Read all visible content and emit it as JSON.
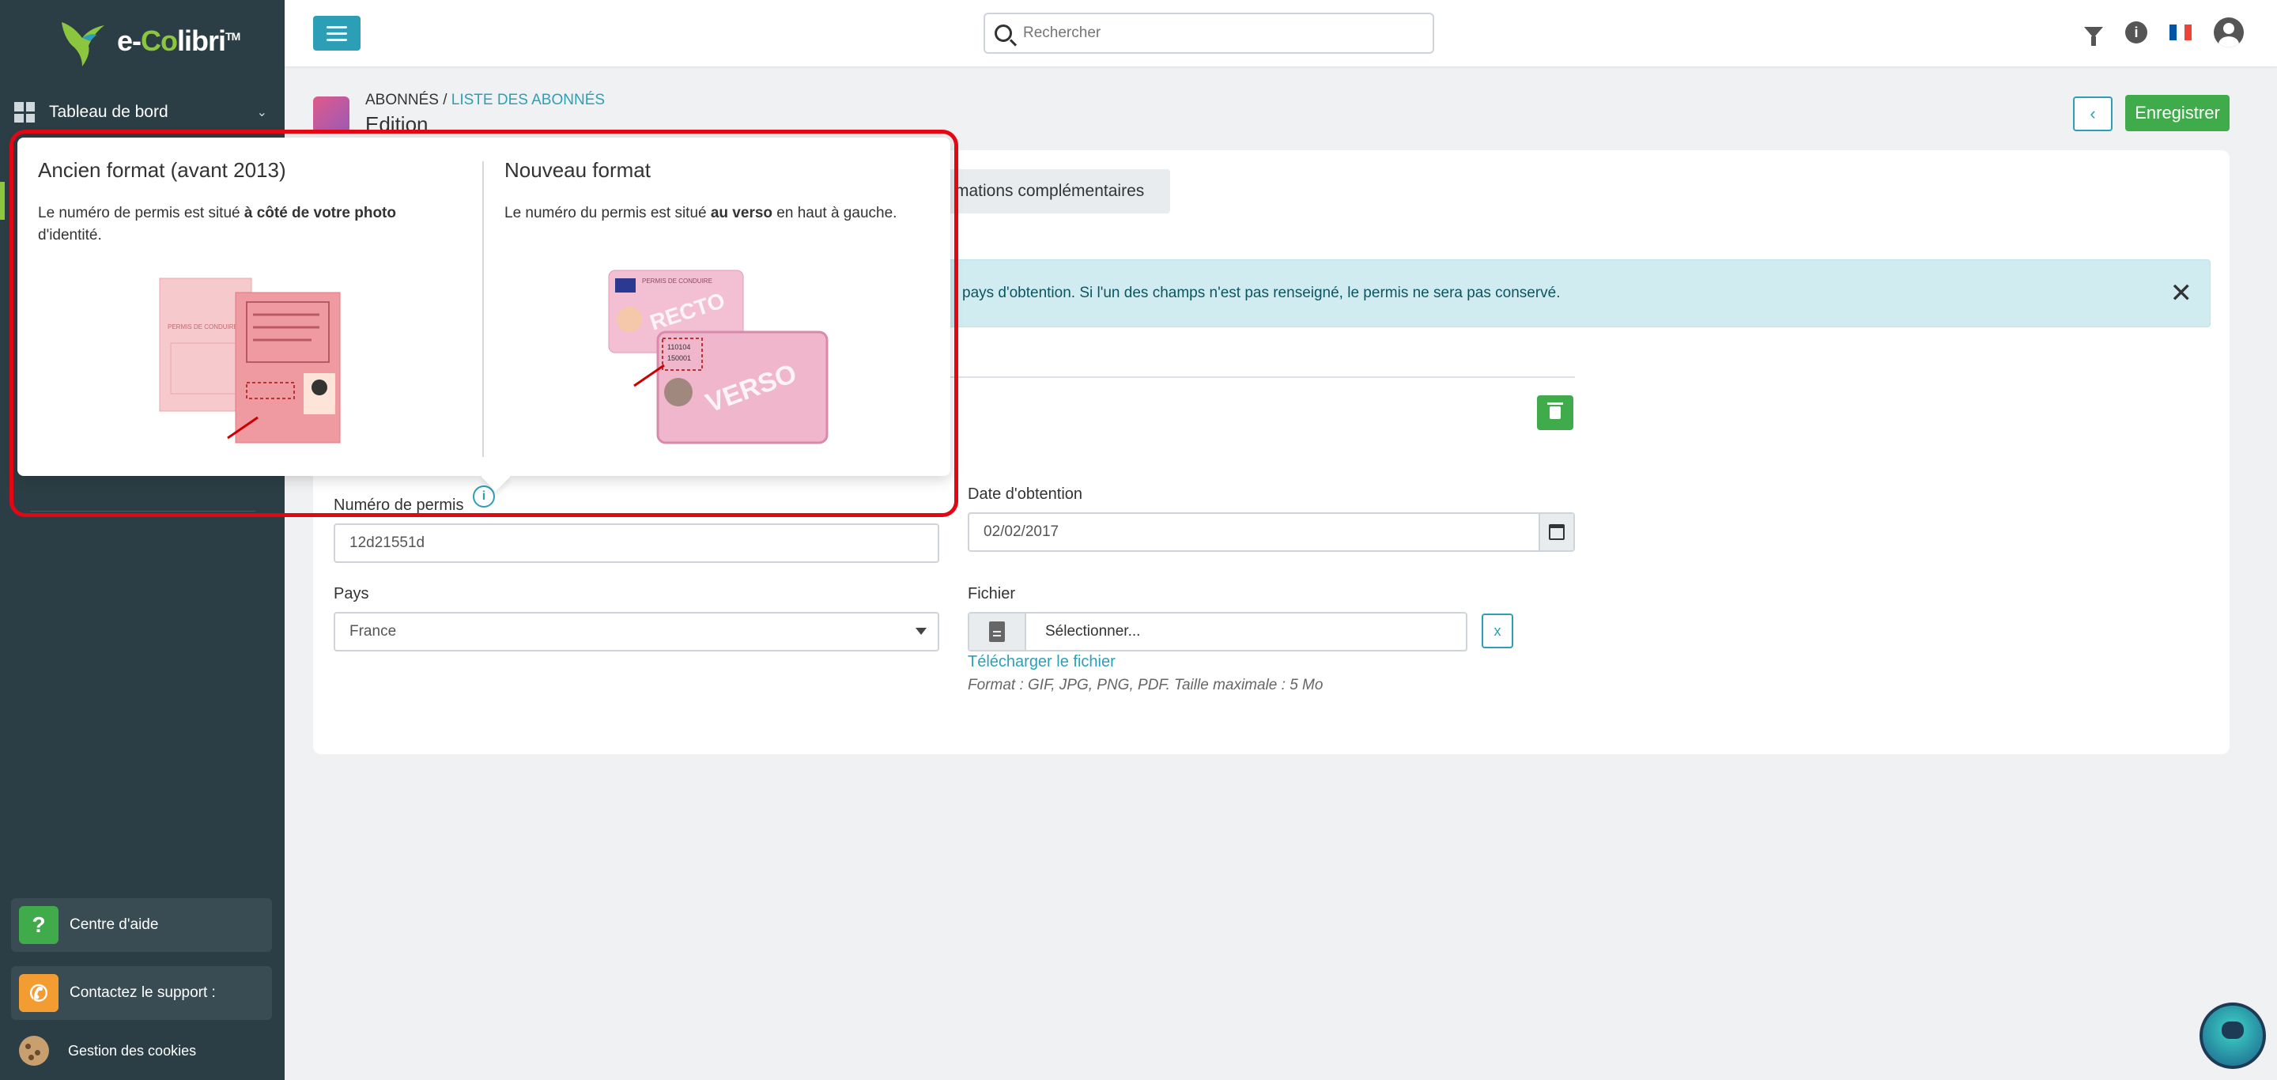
{
  "app": {
    "logo_text_e": "e-",
    "logo_text_co": "Co",
    "logo_text_libri": "libri",
    "logo_tm": "TM"
  },
  "sidebar": {
    "dashboard_label": "Tableau de bord",
    "help_label": "Centre d'aide",
    "support_label": "Contactez le support :",
    "cookies_label": "Gestion des cookies"
  },
  "topbar": {
    "search_placeholder": "Rechercher"
  },
  "header": {
    "breadcrumb_root": "ABONNÉS",
    "breadcrumb_sep": " / ",
    "breadcrumb_link": "LISTE DES ABONNÉS",
    "title": "Edition",
    "save_label": "Enregistrer",
    "back_label": "‹"
  },
  "tabs": {
    "complementary": "mations complémentaires"
  },
  "alert": {
    "text": "pays d'obtention. Si l'un des champs n'est pas renseigné, le permis ne sera pas conservé.",
    "close": "✕"
  },
  "form": {
    "permit_number_label": "Numéro de permis",
    "permit_number_value": "12d21551d",
    "date_label": "Date d'obtention",
    "date_value": "02/02/2017",
    "country_label": "Pays",
    "country_value": "France",
    "file_label": "Fichier",
    "file_value": "Sélectionner...",
    "file_clear": "x",
    "download_link": "Télécharger le fichier",
    "format_hint": "Format : GIF, JPG, PNG, PDF. Taille maximale : 5 Mo",
    "info_glyph": "i"
  },
  "popover": {
    "old_title": "Ancien format (avant 2013)",
    "old_text_a": "Le numéro de permis est situé ",
    "old_text_b": "à côté de votre photo",
    "old_text_c": "d'identité.",
    "new_title": "Nouveau format",
    "new_text_a": "Le numéro du permis est situé ",
    "new_text_b": "au verso",
    "new_text_c": " en haut à gauche.",
    "old_card_label": "PERMIS DE CONDUIRE",
    "recto_label": "RECTO",
    "verso_label": "VERSO",
    "new_card_header": "PERMIS DE CONDUIRE",
    "verso_number_1": "110104",
    "verso_number_2": "150001"
  },
  "colors": {
    "accent": "#2c9fb7",
    "success": "#3fab4b",
    "highlight": "#e30613",
    "sidebar": "#2c3e45"
  },
  "icons": [
    "menu-icon",
    "search-icon",
    "filter-icon",
    "info-icon",
    "flag-fr-icon",
    "user-icon",
    "dashboard-icon",
    "chevron-down-icon",
    "help-icon",
    "phone-icon",
    "cookie-icon",
    "calendar-icon",
    "file-icon",
    "trash-icon",
    "close-icon",
    "assistant-bot-icon"
  ]
}
